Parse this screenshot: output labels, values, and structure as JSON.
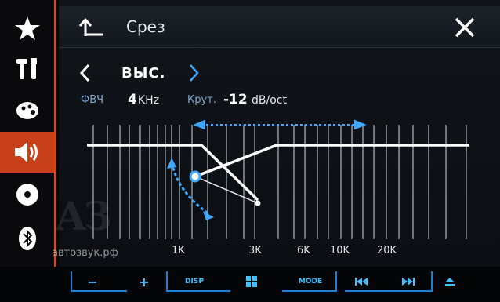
{
  "sidebar": {
    "items": [
      {
        "icon": "star-icon",
        "active": false
      },
      {
        "icon": "tools-icon",
        "active": false
      },
      {
        "icon": "palette-icon",
        "active": false
      },
      {
        "icon": "speaker-icon",
        "active": true
      },
      {
        "icon": "disc-icon",
        "active": false
      },
      {
        "icon": "bluetooth-icon",
        "active": false
      }
    ]
  },
  "header": {
    "title": "Срез",
    "back_icon": "back-arrow-icon",
    "close_icon": "close-icon"
  },
  "band": {
    "label": "ВЫС.",
    "prev_icon": "chevron-left-icon",
    "next_icon": "chevron-right-icon"
  },
  "filter": {
    "type_label": "ФВЧ",
    "freq_value": "4",
    "freq_unit": "KHz",
    "slope_label": "Крут.",
    "slope_value": "-12",
    "slope_unit": "dB/oct"
  },
  "graph": {
    "x_ticks": [
      "1K",
      "3K",
      "6K",
      "10K",
      "20K"
    ],
    "colors": {
      "line": "#3ea9ff",
      "curve": "#ffffff",
      "grid": "#c9d4df"
    }
  },
  "watermark": {
    "logo": "АЗ",
    "text": "автозвук.рф"
  },
  "hardware_buttons": [
    "−",
    "+",
    "DISP",
    "MENU",
    "MODE",
    "PREV",
    "NEXT",
    "EJECT"
  ],
  "accent_color": "#d64a1a"
}
